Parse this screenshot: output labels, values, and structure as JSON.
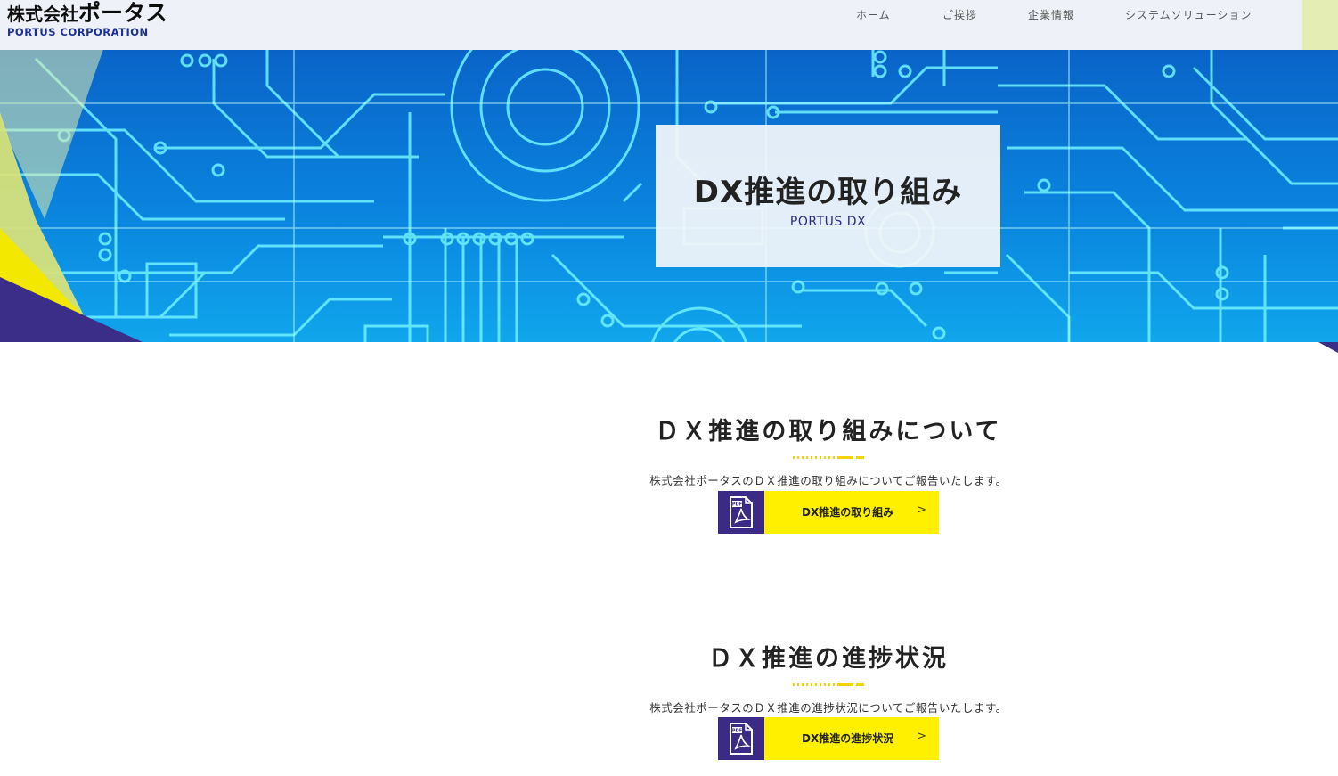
{
  "header": {
    "logo_jp_prefix": "株式会社",
    "logo_jp_name": "ポータス",
    "logo_en": "PORTUS CORPORATION",
    "nav": [
      {
        "label": "ホーム"
      },
      {
        "label": "ご挨拶"
      },
      {
        "label": "企業情報"
      },
      {
        "label": "システムソリューション"
      }
    ]
  },
  "hero": {
    "title": "DX推進の取り組み",
    "subtitle": "PORTUS DX"
  },
  "sections": [
    {
      "title": "ＤＸ推進の取り組みについて",
      "description": "株式会社ポータスのＤＸ推進の取り組みについてご報告いたします。",
      "button_label": "DX推進の取り組み",
      "button_arrow": ">",
      "button_icon": "pdf-icon"
    },
    {
      "title": "ＤＸ推進の進捗状況",
      "description": "株式会社ポータスのＤＸ推進の進捗状況についてご報告いたします。",
      "button_label": "DX推進の進捗状況",
      "button_arrow": ">",
      "button_icon": "pdf-icon"
    }
  ],
  "colors": {
    "accent_yellow": "#fff000",
    "accent_purple": "#3b2a86",
    "hero_blue": "#0a84de",
    "circuit_cyan": "#6ff2ff"
  }
}
